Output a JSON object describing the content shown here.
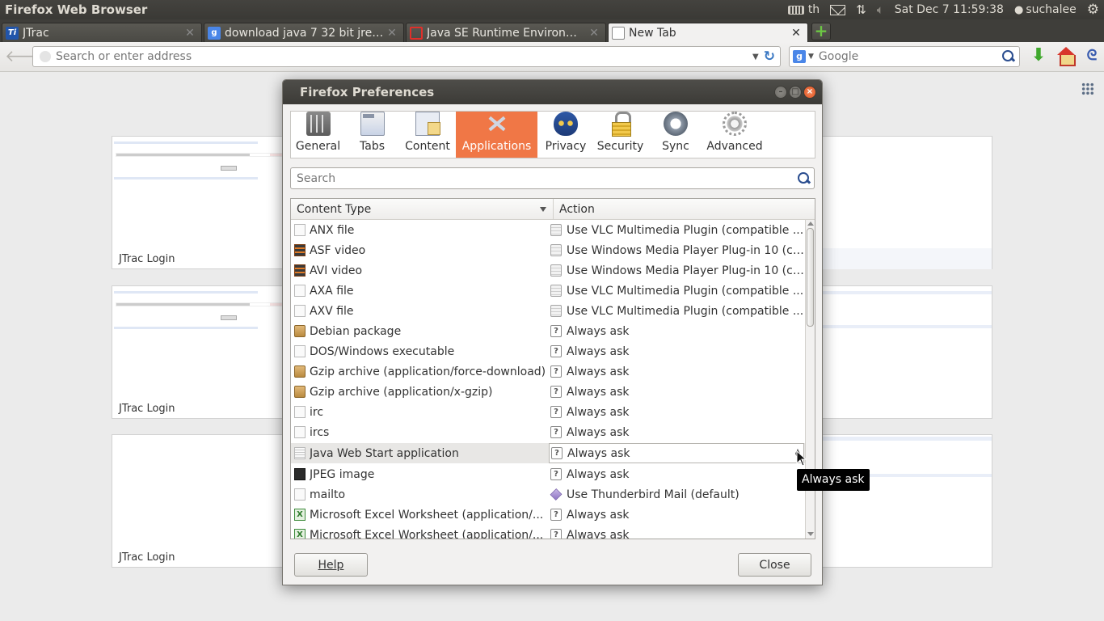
{
  "top_panel": {
    "window_title": "Firefox Web Browser",
    "keyboard_layout": "th",
    "clock": "Sat Dec 7 11:59:38",
    "user": "suchalee",
    "icons": [
      "keyboard-icon",
      "mail-icon",
      "network-icon",
      "volume-mute-icon",
      "user-icon",
      "settings-gear-icon"
    ]
  },
  "tabs": [
    {
      "label": "JTrac",
      "favicon": "jtrac-icon",
      "active": false
    },
    {
      "label": "download java 7 32 bit jre - ...",
      "favicon": "google-icon",
      "active": false
    },
    {
      "label": "Java SE Runtime Environme...",
      "favicon": "oracle-icon",
      "active": false
    },
    {
      "label": "New Tab",
      "favicon": "blank-page-icon",
      "active": true
    }
  ],
  "tab_close_glyph": "✕",
  "nav": {
    "url_placeholder": "Search or enter address",
    "search_placeholder": "Google",
    "search_engine_letter": "g"
  },
  "newtab": {
    "thumbnail_caption": "JTrac Login",
    "thumbnails": [
      {
        "caption": "JTrac Login"
      },
      {
        "caption": "JTrac Login"
      },
      {
        "caption": "JTrac Login"
      }
    ]
  },
  "dialog": {
    "title": "Firefox Preferences",
    "panes": [
      {
        "label": "General",
        "icon": "general-sliders-icon",
        "active": false
      },
      {
        "label": "Tabs",
        "icon": "tabs-icon",
        "active": false
      },
      {
        "label": "Content",
        "icon": "content-icon",
        "active": false
      },
      {
        "label": "Applications",
        "icon": "applications-icon",
        "active": true
      },
      {
        "label": "Privacy",
        "icon": "privacy-mask-icon",
        "active": false
      },
      {
        "label": "Security",
        "icon": "security-lock-icon",
        "active": false
      },
      {
        "label": "Sync",
        "icon": "sync-icon",
        "active": false
      },
      {
        "label": "Advanced",
        "icon": "advanced-gear-icon",
        "active": false
      }
    ],
    "search_placeholder": "Search",
    "columns": {
      "content_type": "Content Type",
      "action": "Action"
    },
    "rows": [
      {
        "type": "ANX file",
        "action": "Use VLC Multimedia Plugin (compatible ...",
        "type_icon": "generic",
        "action_icon": "plugin"
      },
      {
        "type": "ASF video",
        "action": "Use Windows Media Player Plug-in 10 (co...",
        "type_icon": "video",
        "action_icon": "plugin"
      },
      {
        "type": "AVI video",
        "action": "Use Windows Media Player Plug-in 10 (co...",
        "type_icon": "video",
        "action_icon": "plugin"
      },
      {
        "type": "AXA file",
        "action": "Use VLC Multimedia Plugin (compatible ...",
        "type_icon": "generic",
        "action_icon": "plugin"
      },
      {
        "type": "AXV file",
        "action": "Use VLC Multimedia Plugin (compatible ...",
        "type_icon": "generic",
        "action_icon": "plugin"
      },
      {
        "type": "Debian package",
        "action": "Always ask",
        "type_icon": "package",
        "action_icon": "ask"
      },
      {
        "type": "DOS/Windows executable",
        "action": "Always ask",
        "type_icon": "exec",
        "action_icon": "ask"
      },
      {
        "type": "Gzip archive (application/force-download)",
        "action": "Always ask",
        "type_icon": "package",
        "action_icon": "ask"
      },
      {
        "type": "Gzip archive (application/x-gzip)",
        "action": "Always ask",
        "type_icon": "package",
        "action_icon": "ask"
      },
      {
        "type": "irc",
        "action": "Always ask",
        "type_icon": "generic",
        "action_icon": "ask"
      },
      {
        "type": "ircs",
        "action": "Always ask",
        "type_icon": "generic",
        "action_icon": "ask"
      },
      {
        "type": "Java Web Start application",
        "action": "Always ask",
        "type_icon": "java",
        "action_icon": "ask",
        "selected": true
      },
      {
        "type": "JPEG image",
        "action": "Always ask",
        "type_icon": "image",
        "action_icon": "ask"
      },
      {
        "type": "mailto",
        "action": "Use Thunderbird Mail (default)",
        "type_icon": "generic",
        "action_icon": "mail"
      },
      {
        "type": "Microsoft Excel Worksheet (application/...",
        "action": "Always ask",
        "type_icon": "excel",
        "action_icon": "ask"
      },
      {
        "type": "Microsoft Excel Worksheet (application/...",
        "action": "Always ask",
        "type_icon": "excel",
        "action_icon": "ask"
      }
    ],
    "help_label": "Help",
    "close_label": "Close"
  },
  "tooltip": "Always ask",
  "colors": {
    "accent_active_pane": "#f07746",
    "panel_bg": "#3c3b37",
    "window_close": "#e0521f"
  }
}
